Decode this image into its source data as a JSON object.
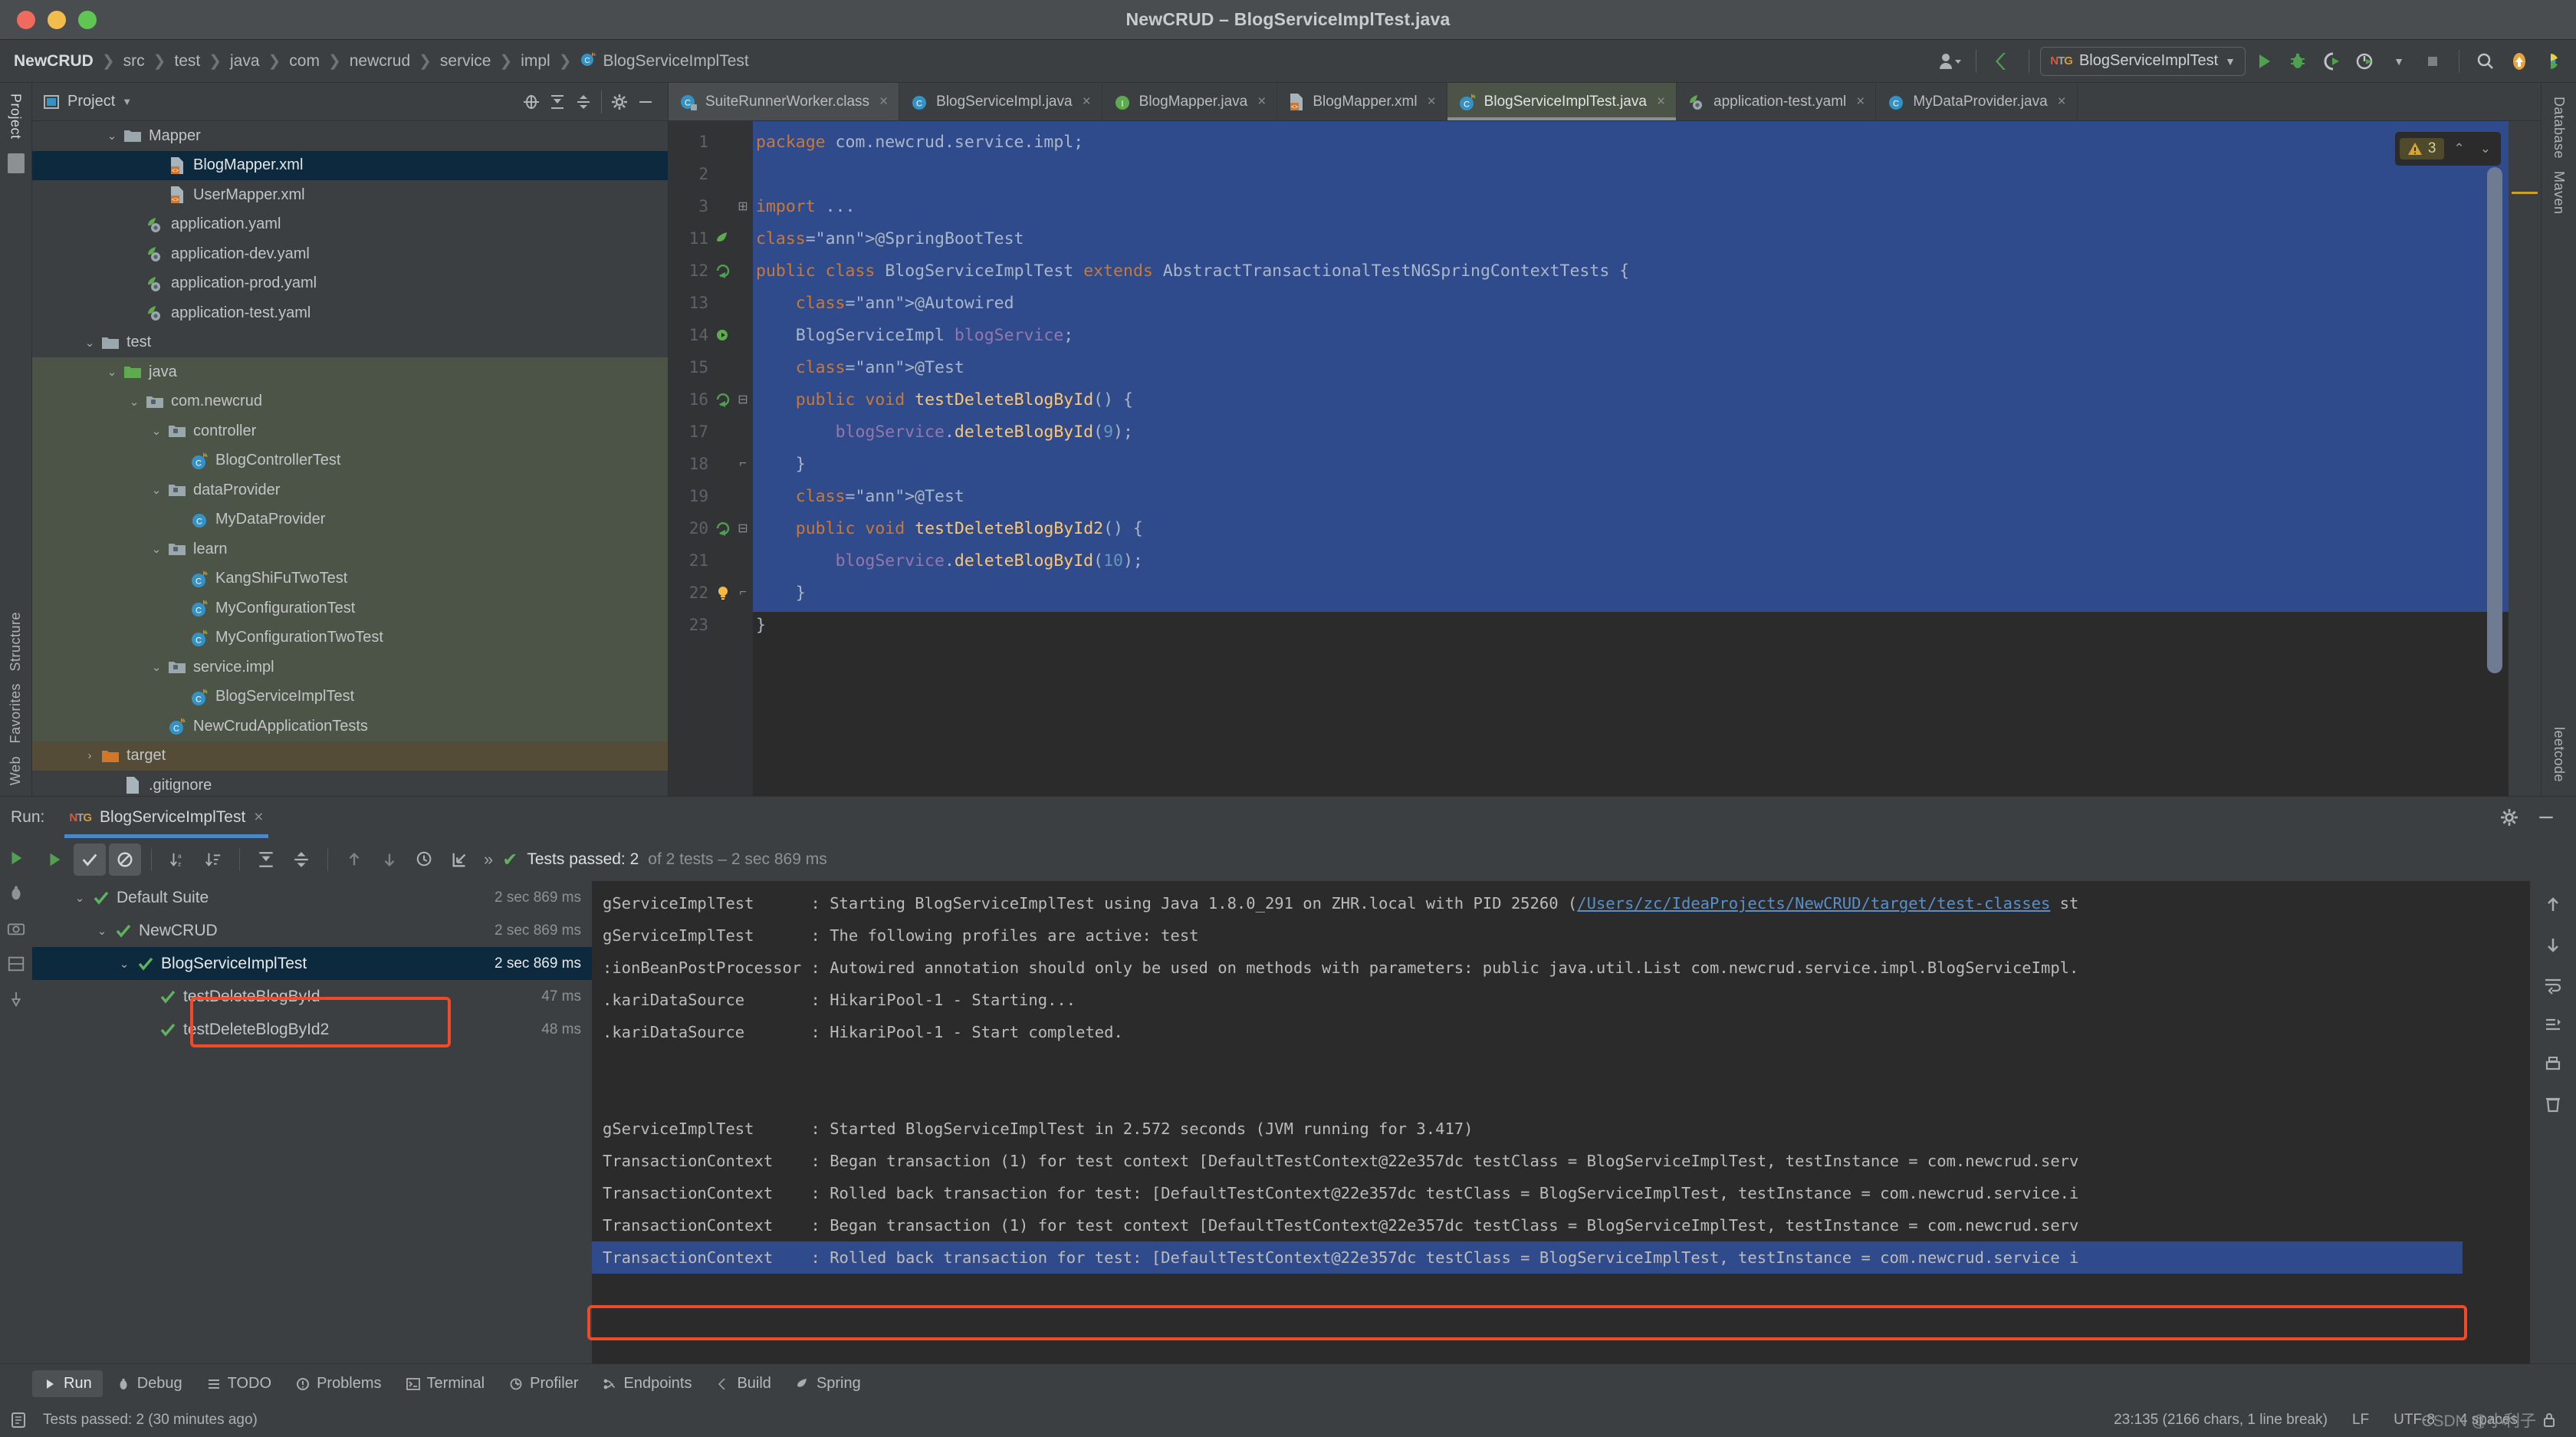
{
  "window": {
    "title": "NewCRUD – BlogServiceImplTest.java"
  },
  "navbar": {
    "breadcrumbs": [
      "NewCRUD",
      "src",
      "test",
      "java",
      "com",
      "newcrud",
      "service",
      "impl",
      "BlogServiceImplTest"
    ],
    "run_config": "BlogServiceImplTest",
    "icons": [
      "user-avatar-icon",
      "build-icon",
      "run-icon",
      "debug-icon",
      "run-with-coverage-icon",
      "profile-icon",
      "stop-icon",
      "search-everywhere-icon",
      "update-project-icon",
      "ide-help-icon"
    ]
  },
  "sidebar_left": {
    "top_label": "Project",
    "bottom_labels": [
      "Structure",
      "Favorites",
      "Web"
    ]
  },
  "sidebar_right": {
    "labels": [
      "Database",
      "Maven",
      "leetcode"
    ]
  },
  "project_panel": {
    "title": "Project",
    "toolbar_icons": [
      "locate-icon",
      "expand-all-icon",
      "collapse-all-icon",
      "gear-icon",
      "hide-icon"
    ],
    "tree": [
      {
        "name": "Mapper",
        "indent": 3,
        "arrow": "v",
        "icon": "folder-icon",
        "state": "normal"
      },
      {
        "name": "BlogMapper.xml",
        "indent": 5,
        "arrow": "",
        "icon": "xml-file-icon",
        "state": "selected"
      },
      {
        "name": "UserMapper.xml",
        "indent": 5,
        "arrow": "",
        "icon": "xml-file-icon",
        "state": "normal"
      },
      {
        "name": "application.yaml",
        "indent": 4,
        "arrow": "",
        "icon": "spring-yaml-icon",
        "state": "normal"
      },
      {
        "name": "application-dev.yaml",
        "indent": 4,
        "arrow": "",
        "icon": "spring-yaml-icon",
        "state": "normal"
      },
      {
        "name": "application-prod.yaml",
        "indent": 4,
        "arrow": "",
        "icon": "spring-yaml-icon",
        "state": "normal"
      },
      {
        "name": "application-test.yaml",
        "indent": 4,
        "arrow": "",
        "icon": "spring-yaml-icon",
        "state": "normal"
      },
      {
        "name": "test",
        "indent": 2,
        "arrow": "v",
        "icon": "folder-icon",
        "state": "normal"
      },
      {
        "name": "java",
        "indent": 3,
        "arrow": "v",
        "icon": "test-source-folder-icon",
        "state": "testsrc"
      },
      {
        "name": "com.newcrud",
        "indent": 4,
        "arrow": "v",
        "icon": "package-icon",
        "state": "testsrc"
      },
      {
        "name": "controller",
        "indent": 5,
        "arrow": "v",
        "icon": "package-icon",
        "state": "testsrc"
      },
      {
        "name": "BlogControllerTest",
        "indent": 6,
        "arrow": "",
        "icon": "test-class-icon",
        "state": "testsrc"
      },
      {
        "name": "dataProvider",
        "indent": 5,
        "arrow": "v",
        "icon": "package-icon",
        "state": "testsrc"
      },
      {
        "name": "MyDataProvider",
        "indent": 6,
        "arrow": "",
        "icon": "class-icon",
        "state": "testsrc"
      },
      {
        "name": "learn",
        "indent": 5,
        "arrow": "v",
        "icon": "package-icon",
        "state": "testsrc"
      },
      {
        "name": "KangShiFuTwoTest",
        "indent": 6,
        "arrow": "",
        "icon": "test-class-icon",
        "state": "testsrc"
      },
      {
        "name": "MyConfigurationTest",
        "indent": 6,
        "arrow": "",
        "icon": "test-class-icon",
        "state": "testsrc"
      },
      {
        "name": "MyConfigurationTwoTest",
        "indent": 6,
        "arrow": "",
        "icon": "test-class-icon",
        "state": "testsrc"
      },
      {
        "name": "service.impl",
        "indent": 5,
        "arrow": "v",
        "icon": "package-icon",
        "state": "testsrc"
      },
      {
        "name": "BlogServiceImplTest",
        "indent": 6,
        "arrow": "",
        "icon": "test-class-icon",
        "state": "testsrc"
      },
      {
        "name": "NewCrudApplicationTests",
        "indent": 5,
        "arrow": "",
        "icon": "test-class-icon",
        "state": "testsrc"
      },
      {
        "name": "target",
        "indent": 2,
        "arrow": ">",
        "icon": "excluded-folder-icon",
        "state": "target"
      },
      {
        "name": ".gitignore",
        "indent": 3,
        "arrow": "",
        "icon": "file-icon",
        "state": "normal"
      }
    ]
  },
  "editor": {
    "tabs": [
      {
        "label": "SuiteRunnerWorker.class",
        "icon": "class-file-icon",
        "active": false,
        "grey": true
      },
      {
        "label": "BlogServiceImpl.java",
        "icon": "class-icon",
        "active": false,
        "grey": false
      },
      {
        "label": "BlogMapper.java",
        "icon": "interface-icon",
        "active": false,
        "grey": false
      },
      {
        "label": "BlogMapper.xml",
        "icon": "xml-file-icon",
        "active": false,
        "grey": false
      },
      {
        "label": "BlogServiceImplTest.java",
        "icon": "test-class-icon",
        "active": true,
        "grey": false
      },
      {
        "label": "application-test.yaml",
        "icon": "spring-yaml-icon",
        "active": false,
        "grey": false
      },
      {
        "label": "MyDataProvider.java",
        "icon": "class-icon",
        "active": false,
        "grey": false
      }
    ],
    "tab_close_label": "×",
    "inspection": {
      "count": "3",
      "icon": "warning-triangle-icon",
      "up": "⌃",
      "down": "⌄"
    },
    "lines": [
      {
        "num": "1",
        "marker": "",
        "fold": "",
        "text": "package com.newcrud.service.impl;"
      },
      {
        "num": "2",
        "marker": "",
        "fold": "",
        "text": ""
      },
      {
        "num": "3",
        "marker": "",
        "fold": "+",
        "text": "import ..."
      },
      {
        "num": "11",
        "marker": "spring",
        "fold": "",
        "text": "@SpringBootTest"
      },
      {
        "num": "12",
        "marker": "testrun",
        "fold": "",
        "text": "public class BlogServiceImplTest extends AbstractTransactionalTestNGSpringContextTests {"
      },
      {
        "num": "13",
        "marker": "",
        "fold": "",
        "text": "    @Autowired"
      },
      {
        "num": "14",
        "marker": "bean",
        "fold": "",
        "text": "    BlogServiceImpl blogService;"
      },
      {
        "num": "15",
        "marker": "",
        "fold": "",
        "text": "    @Test"
      },
      {
        "num": "16",
        "marker": "testrun",
        "fold": "-",
        "text": "    public void testDeleteBlogById() {"
      },
      {
        "num": "17",
        "marker": "",
        "fold": "",
        "text": "        blogService.deleteBlogById(9);"
      },
      {
        "num": "18",
        "marker": "",
        "fold": "^",
        "text": "    }"
      },
      {
        "num": "19",
        "marker": "",
        "fold": "",
        "text": "    @Test"
      },
      {
        "num": "20",
        "marker": "testrun",
        "fold": "-",
        "text": "    public void testDeleteBlogById2() {"
      },
      {
        "num": "21",
        "marker": "",
        "fold": "",
        "text": "        blogService.deleteBlogById(10);"
      },
      {
        "num": "22",
        "marker": "lamp",
        "fold": "^",
        "text": "    }"
      },
      {
        "num": "23",
        "marker": "",
        "fold": "",
        "text": "}"
      }
    ]
  },
  "run_panel": {
    "label": "Run:",
    "tab": "BlogServiceImplTest",
    "tab_close": "×",
    "toolbar_icons": [
      "rerun-icon",
      "show-passed-icon",
      "show-ignored-icon",
      "sort-alphabetically-icon",
      "sort-by-duration-icon",
      "expand-all-icon",
      "collapse-all-icon",
      "prev-failed-icon",
      "next-failed-icon",
      "history-icon",
      "export-icon"
    ],
    "expand_chevron": "»",
    "status": {
      "check": "✔",
      "passed": "Tests passed: 2",
      "rest": "of 2 tests – 2 sec 869 ms"
    },
    "left_icons": [
      "rerun-icon",
      "debug-icon",
      "screenshot-icon",
      "layout-icon",
      "pin-icon"
    ],
    "tests": [
      {
        "name": "Default Suite",
        "time": "2 sec 869 ms",
        "indent": 1,
        "arrow": "v",
        "state": "normal"
      },
      {
        "name": "NewCRUD",
        "time": "2 sec 869 ms",
        "indent": 2,
        "arrow": "v",
        "state": "normal"
      },
      {
        "name": "BlogServiceImplTest",
        "time": "2 sec 869 ms",
        "indent": 3,
        "arrow": "v",
        "state": "selected"
      },
      {
        "name": "testDeleteBlogById",
        "time": "47 ms",
        "indent": 4,
        "arrow": "",
        "state": "normal"
      },
      {
        "name": "testDeleteBlogById2",
        "time": "48 ms",
        "indent": 4,
        "arrow": "",
        "state": "normal"
      }
    ],
    "console": {
      "lines": [
        {
          "y": 0,
          "pre": "gServiceImplTest      : Starting BlogServiceImplTest using Java 1.8.0_291 on ZHR.local with PID 25260 (",
          "link": "/Users/zc/IdeaProjects/NewCRUD/target/test-classes",
          "post": " st",
          "highlight": false
        },
        {
          "y": 1,
          "pre": "gServiceImplTest      : The following profiles are active: test",
          "link": "",
          "post": "",
          "highlight": false
        },
        {
          "y": 2,
          "pre": ":ionBeanPostProcessor : Autowired annotation should only be used on methods with parameters: public java.util.List com.newcrud.service.impl.BlogServiceImpl.",
          "link": "",
          "post": "",
          "highlight": false
        },
        {
          "y": 3,
          "pre": ".kariDataSource       : HikariPool-1 - Starting...",
          "link": "",
          "post": "",
          "highlight": false
        },
        {
          "y": 4,
          "pre": ".kariDataSource       : HikariPool-1 - Start completed.",
          "link": "",
          "post": "",
          "highlight": false
        },
        {
          "y": 5,
          "pre": "",
          "link": "",
          "post": "",
          "highlight": false
        },
        {
          "y": 6,
          "pre": "",
          "link": "",
          "post": "",
          "highlight": false
        },
        {
          "y": 7,
          "pre": "gServiceImplTest      : Started BlogServiceImplTest in 2.572 seconds (JVM running for 3.417)",
          "link": "",
          "post": "",
          "highlight": false
        },
        {
          "y": 8,
          "pre": "TransactionContext    : Began transaction (1) for test context [DefaultTestContext@22e357dc testClass = BlogServiceImplTest, testInstance = com.newcrud.serv",
          "link": "",
          "post": "",
          "highlight": false
        },
        {
          "y": 9,
          "pre": "TransactionContext    : Rolled back transaction for test: [DefaultTestContext@22e357dc testClass = BlogServiceImplTest, testInstance = com.newcrud.service.i",
          "link": "",
          "post": "",
          "highlight": false
        },
        {
          "y": 10,
          "pre": "TransactionContext    : Began transaction (1) for test context [DefaultTestContext@22e357dc testClass = BlogServiceImplTest, testInstance = com.newcrud.serv",
          "link": "",
          "post": "",
          "highlight": false
        },
        {
          "y": 11,
          "pre": "TransactionContext    : Rolled back transaction for test: [DefaultTestContext@22e357dc testClass = BlogServiceImplTest, testInstance = com.newcrud.service i",
          "link": "",
          "post": "",
          "highlight": true
        }
      ],
      "right_icons": [
        "scroll-up-icon",
        "scroll-down-icon",
        "soft-wrap-icon",
        "scroll-to-end-icon",
        "print-icon",
        "clear-all-icon"
      ]
    }
  },
  "bottom_bar": {
    "items": [
      {
        "label": "Run",
        "icon": "run-icon",
        "active": true
      },
      {
        "label": "Debug",
        "icon": "debug-icon",
        "active": false
      },
      {
        "label": "TODO",
        "icon": "todo-icon",
        "active": false
      },
      {
        "label": "Problems",
        "icon": "problems-icon",
        "active": false
      },
      {
        "label": "Terminal",
        "icon": "terminal-icon",
        "active": false
      },
      {
        "label": "Profiler",
        "icon": "profiler-icon",
        "active": false
      },
      {
        "label": "Endpoints",
        "icon": "endpoints-icon",
        "active": false
      },
      {
        "label": "Build",
        "icon": "build-icon",
        "active": false
      },
      {
        "label": "Spring",
        "icon": "spring-icon",
        "active": false
      }
    ]
  },
  "status_bar": {
    "message_icon": "event-log-icon",
    "message": "Tests passed: 2 (30 minutes ago)",
    "caret": "23:135 (2166 chars, 1 line break)",
    "line_sep": "LF",
    "encoding": "UTF-8",
    "indent": "4 spaces",
    "watermark": "CSDN @小利子",
    "lock_icon": "lock-icon"
  },
  "colors": {
    "accent": "#4a88c7",
    "selection": "#2f4b8c",
    "test_src": "#4c5447",
    "target": "#554c38",
    "pass_green": "#5fb25f",
    "annotation_red": "#f04a28"
  }
}
